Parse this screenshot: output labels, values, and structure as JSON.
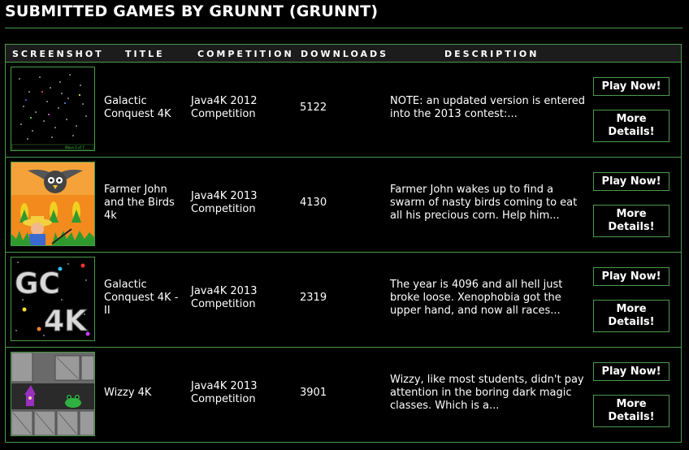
{
  "page": {
    "title": "SUBMITTED GAMES BY GRUNNT (GRUNNT)"
  },
  "table": {
    "headers": {
      "screenshot": "SCREENSHOT",
      "title": "TITLE",
      "competition": "COMPETITION",
      "downloads": "DOWNLOADS",
      "description": "DESCRIPTION"
    },
    "rows": [
      {
        "title": "Galactic Conquest 4K",
        "competition": "Java4K 2012 Competition",
        "downloads": "5122",
        "description": "NOTE: an updated version is entered into the 2013 contest:...",
        "play_label": "Play Now!",
        "more_label": "More Details!",
        "thumb_text": "Wave 0 of 7"
      },
      {
        "title": "Farmer John and the Birds 4k",
        "competition": "Java4K 2013 Competition",
        "downloads": "4130",
        "description": "Farmer John wakes up to find a swarm of nasty birds coming to eat all his precious corn. Help him...",
        "play_label": "Play Now!",
        "more_label": "More Details!"
      },
      {
        "title": "Galactic Conquest 4K - II",
        "competition": "Java4K 2013 Competition",
        "downloads": "2319",
        "description": "The year is 4096 and all hell just broke loose. Xenophobia got the upper hand, and now all races...",
        "play_label": "Play Now!",
        "more_label": "More Details!",
        "thumb_text_1": "GC",
        "thumb_text_2": "4K"
      },
      {
        "title": "Wizzy 4K",
        "competition": "Java4K 2013 Competition",
        "downloads": "3901",
        "description": "Wizzy, like most students, didn't pay attention in the boring dark magic classes. Which is a...",
        "play_label": "Play Now!",
        "more_label": "More Details!"
      }
    ]
  },
  "colors": {
    "background": "#000000",
    "border": "#4a9a4a",
    "header_bg": "#1c1c1c",
    "text": "#ffffff"
  }
}
